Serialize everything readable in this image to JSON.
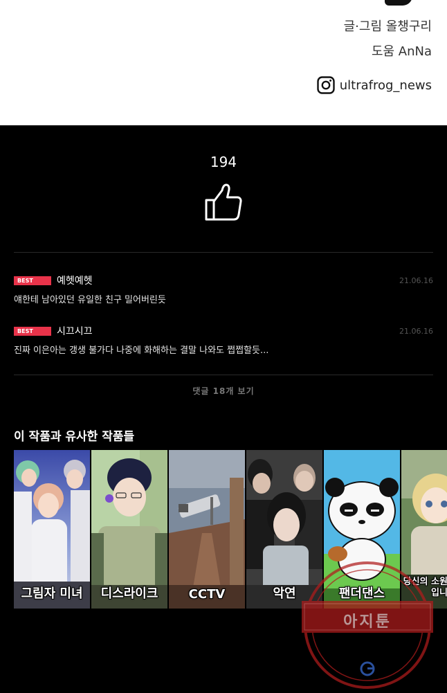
{
  "credits": {
    "author": "글·그림 올챙구리",
    "assist": "도움 AnNa",
    "instagram_handle": "ultrafrog_news",
    "instagram_icon": "instagram-icon"
  },
  "likes": {
    "count": "194",
    "icon": "thumbs-up-icon"
  },
  "comments": [
    {
      "badge": "BEST",
      "name": "예헷예헷",
      "date": "21.06.16",
      "text": "얘한테 남아있던 유일한 친구 밀어버린듯"
    },
    {
      "badge": "BEST",
      "name": "시끄시끄",
      "date": "21.06.16",
      "text": "진짜 이은아는 갱생 불가다 나중에 화해하는 결말 나와도 쩝쩝할듯..."
    }
  ],
  "more_comments": "댓글 18개 보기",
  "similar": {
    "heading": "이 작품과 유사한 작품들",
    "items": [
      {
        "title": "그림자 미녀"
      },
      {
        "title": "디스라이크"
      },
      {
        "title": "CCTV"
      },
      {
        "title": "악연"
      },
      {
        "title": "팬더댄스"
      },
      {
        "title": "당신의 소원을 무엇입니"
      }
    ]
  },
  "watermark": {
    "text": "아지툰",
    "logo": "google-g-icon"
  },
  "colors": {
    "best_badge": "#e8334a",
    "background": "#000000",
    "watermark": "#b01c1c"
  }
}
